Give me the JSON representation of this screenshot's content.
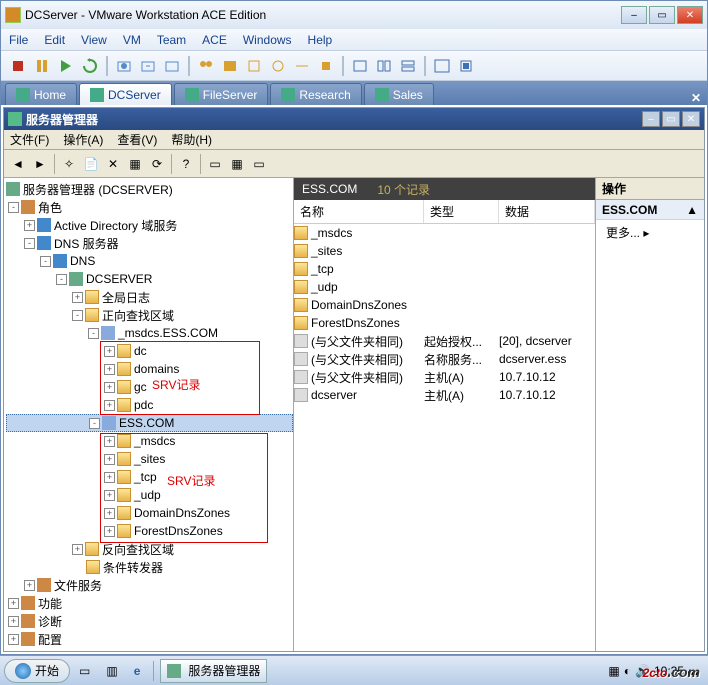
{
  "outer": {
    "title": "DCServer - VMware Workstation ACE Edition",
    "menus": [
      "File",
      "Edit",
      "View",
      "VM",
      "Team",
      "ACE",
      "Windows",
      "Help"
    ]
  },
  "vm_tabs": [
    {
      "label": "Home",
      "active": false
    },
    {
      "label": "DCServer",
      "active": true
    },
    {
      "label": "FileServer",
      "active": false
    },
    {
      "label": "Research",
      "active": false
    },
    {
      "label": "Sales",
      "active": false
    }
  ],
  "sm": {
    "title": "服务器管理器",
    "menus": [
      "文件(F)",
      "操作(A)",
      "查看(V)",
      "帮助(H)"
    ]
  },
  "tree": {
    "root": "服务器管理器 (DCSERVER)",
    "roles": "角色",
    "ad": "Active Directory 域服务",
    "dnsServer": "DNS 服务器",
    "dns": "DNS",
    "dcserver": "DCSERVER",
    "globalLog": "全局日志",
    "fwzone": "正向查找区域",
    "msdcs_zone": "_msdcs.ESS.COM",
    "dc": "dc",
    "domains": "domains",
    "gc": "gc",
    "pdc": "pdc",
    "ess": "ESS.COM",
    "msdcs": "_msdcs",
    "sites": "_sites",
    "tcp": "_tcp",
    "udp": "_udp",
    "ddz": "DomainDnsZones",
    "fdz": "ForestDnsZones",
    "revzone": "反向查找区域",
    "condfwd": "条件转发器",
    "fileServices": "文件服务",
    "features": "功能",
    "diag": "诊断",
    "config": "配置",
    "anno1": "SRV记录",
    "anno2": "SRV记录"
  },
  "list": {
    "hdr_zone": "ESS.COM",
    "hdr_count": "10 个记录",
    "cols": [
      "名称",
      "类型",
      "数据"
    ],
    "rows": [
      {
        "icon": "f",
        "name": "_msdcs",
        "type": "",
        "data": ""
      },
      {
        "icon": "f",
        "name": "_sites",
        "type": "",
        "data": ""
      },
      {
        "icon": "f",
        "name": "_tcp",
        "type": "",
        "data": ""
      },
      {
        "icon": "f",
        "name": "_udp",
        "type": "",
        "data": ""
      },
      {
        "icon": "f",
        "name": "DomainDnsZones",
        "type": "",
        "data": ""
      },
      {
        "icon": "f",
        "name": "ForestDnsZones",
        "type": "",
        "data": ""
      },
      {
        "icon": "r",
        "name": "(与父文件夹相同)",
        "type": "起始授权...",
        "data": "[20], dcserver"
      },
      {
        "icon": "r",
        "name": "(与父文件夹相同)",
        "type": "名称服务...",
        "data": "dcserver.ess"
      },
      {
        "icon": "r",
        "name": "(与父文件夹相同)",
        "type": "主机(A)",
        "data": "10.7.10.12"
      },
      {
        "icon": "r",
        "name": "dcserver",
        "type": "主机(A)",
        "data": "10.7.10.12"
      }
    ]
  },
  "actions": {
    "title": "操作",
    "zone": "ESS.COM",
    "more": "更多..."
  },
  "taskbar": {
    "start": "开始",
    "app": "服务器管理器",
    "clock": "10:35"
  },
  "watermark": {
    "a": "2cto",
    "b": ".com"
  }
}
